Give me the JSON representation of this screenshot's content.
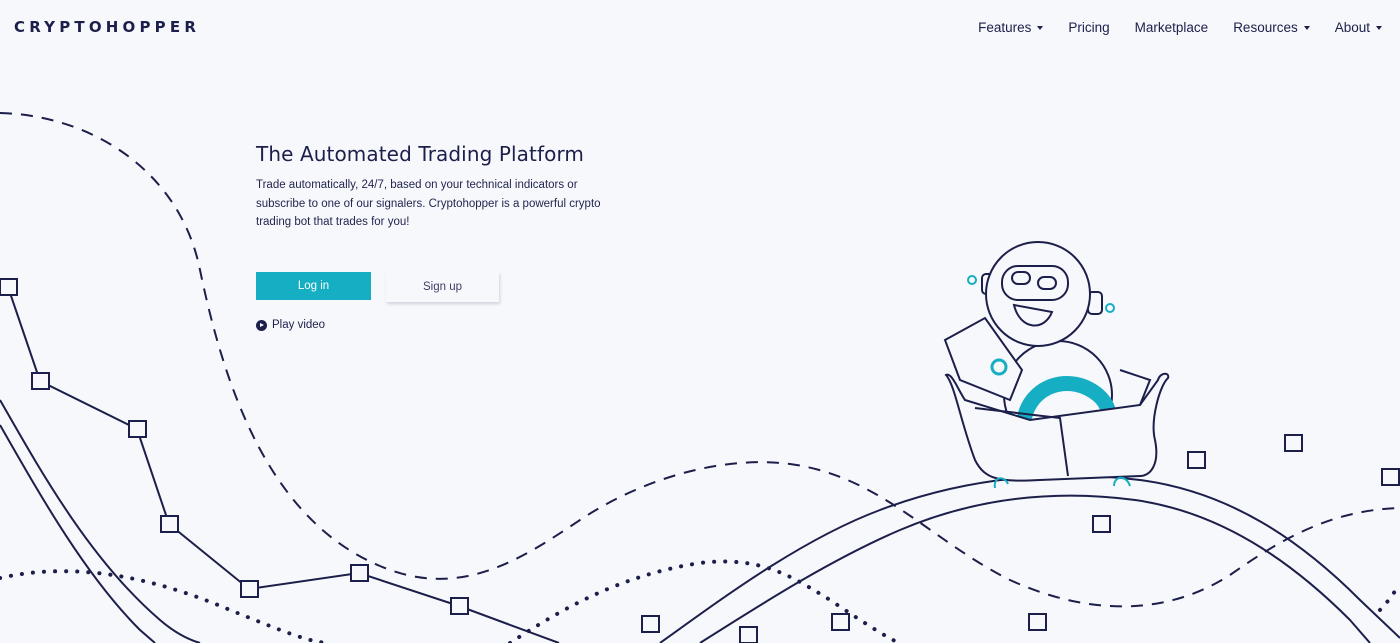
{
  "header": {
    "logo": "CRYPTOHOPPER",
    "nav": [
      {
        "label": "Features",
        "dropdown": true
      },
      {
        "label": "Pricing",
        "dropdown": false
      },
      {
        "label": "Marketplace",
        "dropdown": false
      },
      {
        "label": "Resources",
        "dropdown": true
      },
      {
        "label": "About",
        "dropdown": true
      }
    ]
  },
  "hero": {
    "title": "The Automated Trading Platform",
    "description": "Trade automatically, 24/7, based on your technical indicators or subscribe to one of our signalers. Cryptohopper is a powerful crypto trading bot that trades for you!",
    "login_label": "Log in",
    "signup_label": "Sign up",
    "play_label": "Play video"
  },
  "colors": {
    "accent": "#16aec3",
    "navy": "#1c1f4a",
    "background": "#f7f8fc"
  }
}
